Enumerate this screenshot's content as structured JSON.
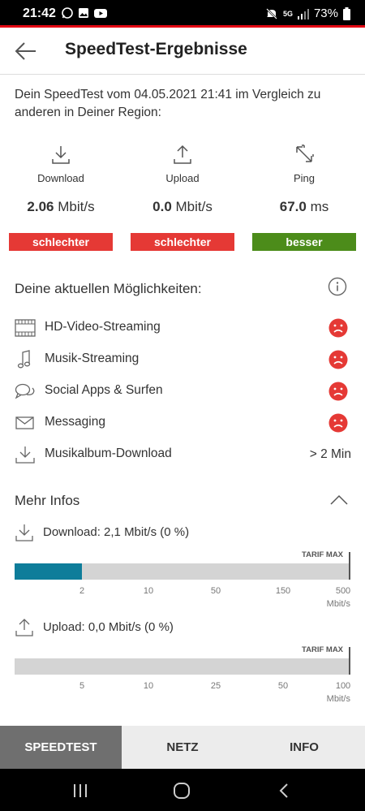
{
  "status_bar": {
    "time": "21:42",
    "battery": "73%",
    "network": "5G"
  },
  "header": {
    "title": "SpeedTest-Ergebnisse"
  },
  "intro": "Dein SpeedTest vom 04.05.2021 21:41 im Vergleich zu anderen in Deiner Region:",
  "metrics": [
    {
      "label": "Download",
      "value": "2.06",
      "unit": "Mbit/s",
      "badge": "schlechter",
      "badge_color": "#e53935",
      "icon": "download-icon"
    },
    {
      "label": "Upload",
      "value": "0.0",
      "unit": "Mbit/s",
      "badge": "schlechter",
      "badge_color": "#e53935",
      "icon": "upload-icon"
    },
    {
      "label": "Ping",
      "value": "67.0",
      "unit": "ms",
      "badge": "besser",
      "badge_color": "#4c8c1a",
      "icon": "ping-icon"
    }
  ],
  "options": {
    "title": "Deine aktuellen Möglichkeiten:",
    "items": [
      {
        "label": "HD-Video-Streaming",
        "icon": "film-icon",
        "status": "sad-face-icon"
      },
      {
        "label": "Musik-Streaming",
        "icon": "music-note-icon",
        "status": "sad-face-icon"
      },
      {
        "label": "Social Apps & Surfen",
        "icon": "chat-bubbles-icon",
        "status": "sad-face-icon"
      },
      {
        "label": "Messaging",
        "icon": "envelope-icon",
        "status": "sad-face-icon"
      },
      {
        "label": "Musikalbum-Download",
        "icon": "download-icon",
        "value": "> 2 Min"
      }
    ]
  },
  "more_info": {
    "title": "Mehr Infos",
    "download": {
      "text": "Download: 2,1 Mbit/s (0 %)",
      "tarif_label": "TARIF MAX",
      "ticks": [
        "2",
        "10",
        "50",
        "150",
        "500"
      ],
      "unit": "Mbit/s",
      "fill_fraction": 0.2
    },
    "upload": {
      "text": "Upload: 0,0 Mbit/s (0 %)",
      "tarif_label": "TARIF MAX",
      "ticks": [
        "5",
        "10",
        "25",
        "50",
        "100"
      ],
      "unit": "Mbit/s",
      "fill_fraction": 0
    }
  },
  "tabs": [
    {
      "label": "SPEEDTEST",
      "active": true
    },
    {
      "label": "NETZ",
      "active": false
    },
    {
      "label": "INFO",
      "active": false
    }
  ],
  "colors": {
    "accent": "#e30613",
    "bar_fill": "#0e7d9a",
    "bad": "#e53935",
    "good": "#4c8c1a"
  }
}
